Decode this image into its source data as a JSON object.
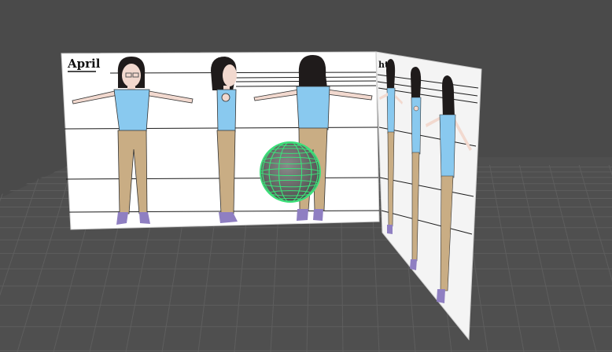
{
  "viewport": {
    "background": "#4a4a4a",
    "grid_color": "#5a5a5a",
    "floor_color": "#6a6a6a"
  },
  "front_sheet": {
    "label": "April",
    "paper_color": "#ffffff",
    "views": [
      "front-view",
      "side-view",
      "back-view"
    ]
  },
  "side_sheet": {
    "label": "ht",
    "paper_color": "#ffffff",
    "views": [
      "front-view",
      "side-view",
      "back-view"
    ]
  },
  "character": {
    "hair_color": "#1f1b1b",
    "skin_color": "#f2d9cf",
    "shirt_color": "#89c9ef",
    "pants_color": "#c9ad84",
    "shoe_color": "#8f7fc2"
  },
  "gizmo": {
    "type": "sphere",
    "color": "#3de07a",
    "fill": "#6b6b6b"
  }
}
